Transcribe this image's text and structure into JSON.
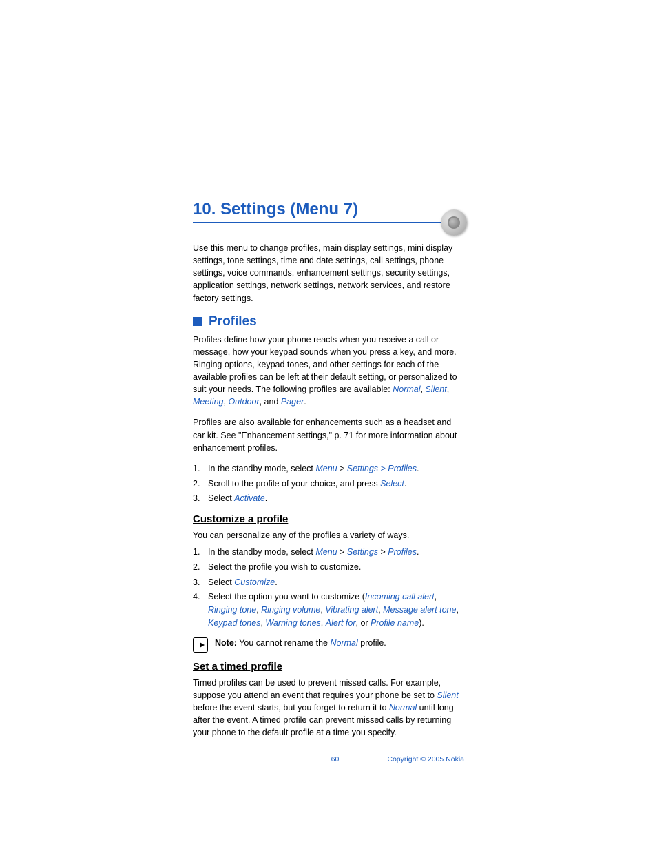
{
  "chapter": {
    "title": "10. Settings (Menu 7)"
  },
  "intro": "Use this menu to change profiles, main display settings, mini display settings, tone settings, time and date settings, call settings, phone settings, voice commands, enhancement settings, security settings, application settings, network settings, network services, and restore factory settings.",
  "profiles": {
    "heading": "Profiles",
    "p1_a": "Profiles define how your phone reacts when you receive a call or message, how your keypad sounds when you press a key, and more. Ringing options, keypad tones, and other settings for each of the available profiles can be left at their default setting, or personalized to suit your needs. The following profiles are available: ",
    "list": {
      "normal": "Normal",
      "silent": "Silent",
      "meeting": "Meeting",
      "outdoor": "Outdoor",
      "pager": "Pager"
    },
    "p1_and": ", and ",
    "p2": "Profiles are also available for enhancements such as a headset and car kit. See \"Enhancement settings,\" p. 71 for more information about enhancement profiles.",
    "steps": {
      "s1_a": "In the standby mode, select ",
      "s1_menu": "Menu",
      "s1_gt": " > ",
      "s1_sp": "Settings > Profiles",
      "s2_a": "Scroll to the profile of your choice, and press ",
      "s2_select": "Select",
      "s3_a": "Select ",
      "s3_activate": "Activate"
    }
  },
  "customize": {
    "heading": "Customize a profile",
    "intro": "You can personalize any of the profiles a variety of ways.",
    "steps": {
      "s1_a": "In the standby mode, select ",
      "s1_menu": "Menu",
      "gt": " > ",
      "s1_settings": "Settings",
      "s1_profiles": "Profiles",
      "s2": "Select the profile you wish to customize.",
      "s3_a": "Select ",
      "s3_customize": "Customize",
      "s4_a": "Select the option you want to customize (",
      "opts": {
        "ica": "Incoming call alert",
        "rt": "Ringing tone",
        "rv": "Ringing volume",
        "va": "Vibrating alert",
        "mat": "Message alert tone",
        "kt": "Keypad tones",
        "wt": "Warning tones",
        "af": "Alert for",
        "pn": "Profile name"
      },
      "s4_or": ", or ",
      "s4_end": ")."
    },
    "note_label": "Note:",
    "note_a": " You cannot rename the ",
    "note_normal": "Normal",
    "note_b": " profile."
  },
  "timed": {
    "heading": "Set a timed profile",
    "p_a": "Timed profiles can be used to prevent missed calls. For example, suppose you attend an event that requires your phone be set to ",
    "silent": "Silent",
    "p_b": " before the event starts, but you forget to return it to ",
    "normal": "Normal",
    "p_c": " until long after the event. A timed profile can prevent missed calls by returning your phone to the default profile at a time you specify."
  },
  "footer": {
    "page": "60",
    "copyright": "Copyright © 2005 Nokia"
  },
  "sep": ", ",
  "period": "."
}
